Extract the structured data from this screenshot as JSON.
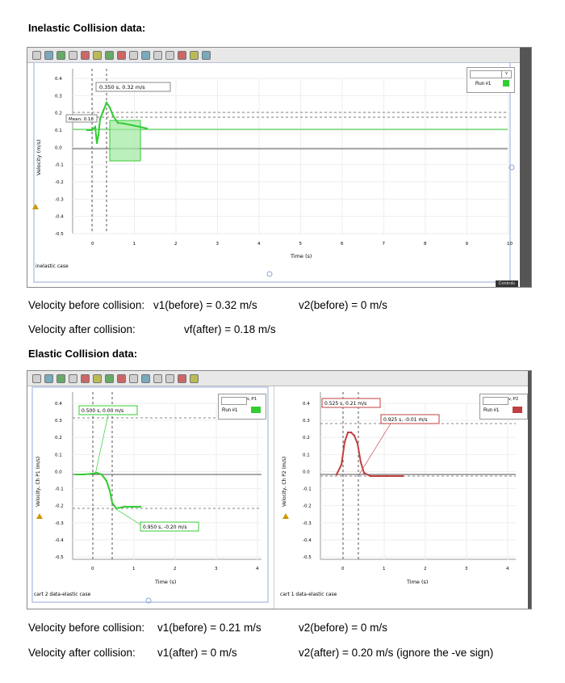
{
  "inelastic": {
    "heading": "Inelastic Collision data:",
    "graph": {
      "yticks": [
        "0.4",
        "0.3",
        "0.2",
        "0.1",
        "0.0",
        "-0.1",
        "-0.2",
        "-0.3",
        "-0.4",
        "-0.5"
      ],
      "xticks": [
        "0",
        "1",
        "2",
        "3",
        "4",
        "5",
        "6",
        "7",
        "8",
        "9",
        "10"
      ],
      "ylabel": "Velocity (m/s)",
      "xlabel": "Time (s)",
      "readout": "0.350 s, 0.32 m/s",
      "mean_label": "Mean: 0.18",
      "run_label": "Run #1",
      "caption": "inelastic case",
      "controls": "Controls"
    },
    "line1_label": "Velocity before collision:",
    "line1_v1": "v1(before) = 0.32 m/s",
    "line1_v2": "v2(before) = 0 m/s",
    "line2_label": "Velocity after collision:",
    "line2_vf": "vf(after) = 0.18 m/s"
  },
  "elastic": {
    "heading": "Elastic Collision data:",
    "graph1": {
      "yticks": [
        "0.4",
        "0.3",
        "0.2",
        "0.1",
        "0.0",
        "-0.1",
        "-0.2",
        "-0.3",
        "-0.4",
        "-0.5"
      ],
      "xticks": [
        "0",
        "1",
        "2",
        "3",
        "4"
      ],
      "ylabel": "Velocity, Ch P1 (m/s)",
      "xlabel": "Time (s)",
      "readout_top": "0.500 s, 0.00 m/s",
      "readout_bottom": "0.950 s, -0.20 m/s",
      "sensor": "v, P1",
      "run_label": "Run #1",
      "caption": "cart 2 data-elastic case"
    },
    "graph2": {
      "yticks": [
        "0.4",
        "0.3",
        "0.2",
        "0.1",
        "0.0",
        "-0.1",
        "-0.2",
        "-0.3",
        "-0.4",
        "-0.5"
      ],
      "xticks": [
        "0",
        "1",
        "2",
        "3",
        "4"
      ],
      "ylabel": "Velocity, Ch P2 (m/s)",
      "xlabel": "Time (s)",
      "readout_top": "0.525 s, 0.21 m/s",
      "readout_mid": "0.925 s, -0.01 m/s",
      "sensor": "v, P2",
      "run_label": "Run #1",
      "caption": "cart 1 data-elastic case"
    },
    "line1_label": "Velocity before collision:",
    "line1_v1": "v1(before) = 0.21 m/s",
    "line1_v2": "v2(before) = 0 m/s",
    "line2_label": "Velocity after collision:",
    "line2_v1": "v1(after) = 0 m/s",
    "line2_v2": "v2(after) = 0.20 m/s (ignore the -ve sign)"
  },
  "colors": {
    "green_series": "#33cc33",
    "red_series": "#c04040"
  }
}
